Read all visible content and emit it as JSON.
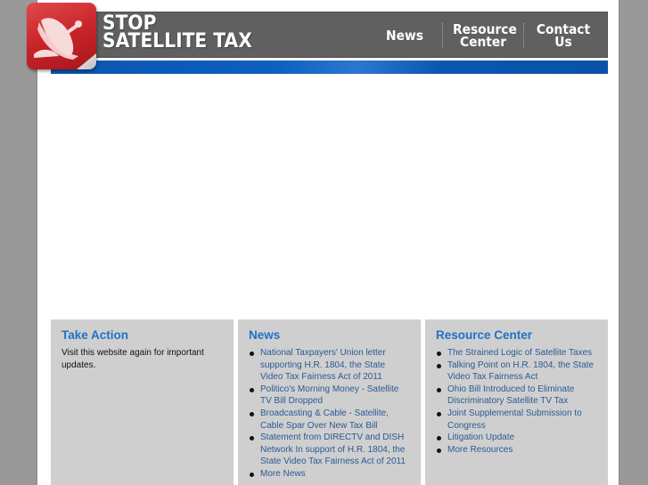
{
  "header": {
    "logo_line1": "STOP",
    "logo_line2": "SATELLITE TAX",
    "logo_icon": "satellite-dish-icon",
    "nav": [
      {
        "label_line1": "News",
        "label_line2": ""
      },
      {
        "label_line1": "Resource",
        "label_line2": "Center"
      },
      {
        "label_line1": "Contact",
        "label_line2": "Us"
      }
    ]
  },
  "columns": {
    "take_action": {
      "title": "Take Action",
      "text": "Visit this website again for important updates."
    },
    "news": {
      "title": "News",
      "items": [
        "National Taxpayers' Union letter supporting H.R. 1804, the State Video Tax Fairness Act of 2011",
        "Politico's Morning Money - Satellite TV Bill Dropped",
        "Broadcasting & Cable - Satellite, Cable Spar Over New Tax Bill",
        "Statement from DIRECTV and DISH Network In support of H.R. 1804, the State Video Tax Fairness Act of 2011",
        "More News"
      ]
    },
    "resource_center": {
      "title": "Resource Center",
      "items": [
        "The Strained Logic of Satellite Taxes",
        "Talking Point on H.R. 1804, the State Video Tax Fairness Act",
        "Ohio Bill Introduced to Eliminate Discriminatory Satellite TV Tax",
        "Joint Supplemental Submission to Congress",
        "Litigation Update",
        "More Resources"
      ]
    }
  },
  "colors": {
    "heading_blue": "#1f72c6",
    "link_blue": "#2a5a94",
    "header_gray": "#606060",
    "accent_blue": "#0b56b0",
    "logo_red": "#c8242a"
  }
}
